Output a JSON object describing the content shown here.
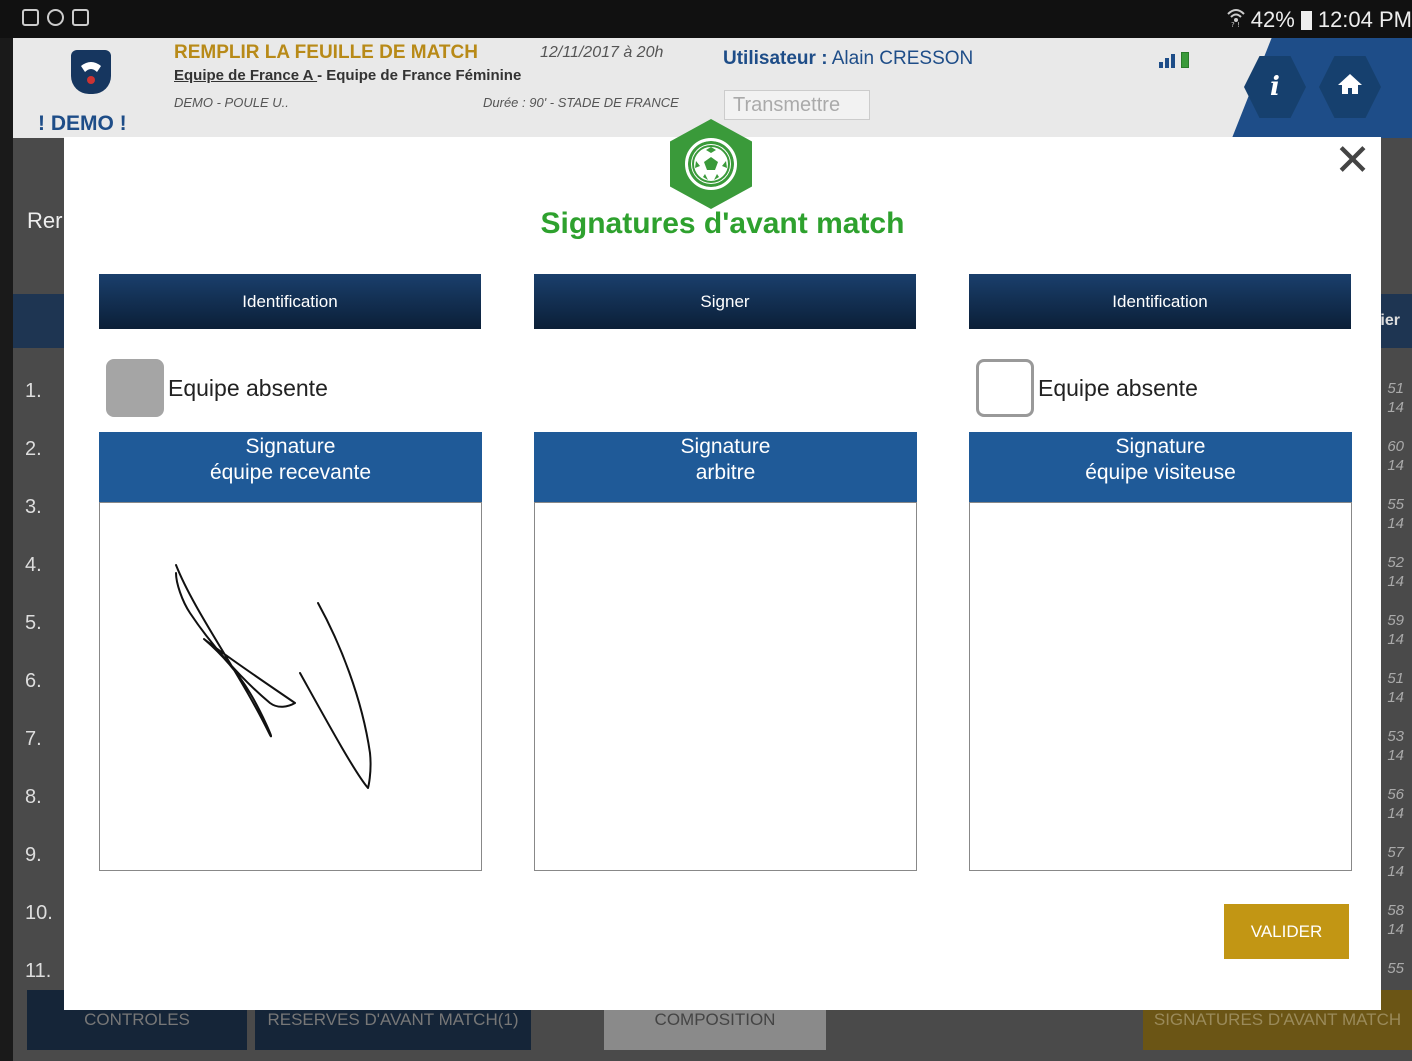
{
  "status_bar": {
    "battery_pct": "42%",
    "time": "12:04 PM"
  },
  "header": {
    "demo_label": "! DEMO !",
    "title": "REMPLIR LA FEUILLE DE MATCH",
    "date": "12/11/2017 à 20h",
    "home_team": "Equipe de France A ",
    "teams_sep": "- ",
    "away_team": "Equipe de France Féminine",
    "poule": "DEMO - POULE U..",
    "duree": "Durée : 90' - STADE DE FRANCE",
    "user_label": "Utilisateur :",
    "user_name": " Alain CRESSON",
    "transmit_label": "Transmettre",
    "info_label": "i"
  },
  "background": {
    "rem_fragment": "Rer",
    "er_fragment": "ier",
    "rows": [
      "1.",
      "2.",
      "3.",
      "4.",
      "5.",
      "6.",
      "7.",
      "8.",
      "9.",
      "10.",
      "11."
    ],
    "side_values": [
      [
        "51",
        "14"
      ],
      [
        "60",
        "14"
      ],
      [
        "55",
        "14"
      ],
      [
        "52",
        "14"
      ],
      [
        "59",
        "14"
      ],
      [
        "51",
        "14"
      ],
      [
        "53",
        "14"
      ],
      [
        "56",
        "14"
      ],
      [
        "57",
        "14"
      ],
      [
        "58",
        "14"
      ],
      [
        "55",
        ""
      ]
    ],
    "tabs": {
      "controls": "CONTROLES",
      "reserves": "RESERVES D'AVANT MATCH(1)",
      "composition": "COMPOSITION",
      "signatures": "SIGNATURES D'AVANT MATCH"
    }
  },
  "modal": {
    "title": "Signatures d'avant match",
    "close_label": "✕",
    "columns": [
      {
        "button": "Identification",
        "absent_label": "Equipe absente",
        "absent_checked": true,
        "sig_title_1": "Signature",
        "sig_title_2": "équipe recevante",
        "signed": true
      },
      {
        "button": "Signer",
        "sig_title_1": "Signature",
        "sig_title_2": "arbitre",
        "signed": false
      },
      {
        "button": "Identification",
        "absent_label": "Equipe absente",
        "absent_checked": false,
        "sig_title_1": "Signature",
        "sig_title_2": "équipe visiteuse",
        "signed": false
      }
    ],
    "validate_label": "VALIDER"
  },
  "colors": {
    "accent_green": "#2ea12e",
    "navy": "#1a3f6c",
    "sig_header_blue": "#1f5a98",
    "validate_gold": "#c29614",
    "header_gold": "#b88a18"
  }
}
